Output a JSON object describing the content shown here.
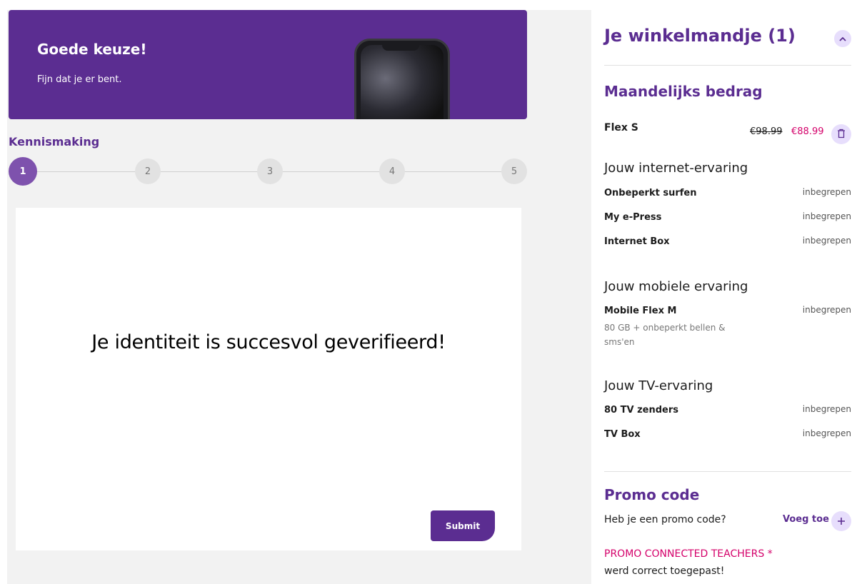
{
  "hero": {
    "title": "Goede keuze!",
    "subtitle": "Fijn dat je er bent."
  },
  "stepper": {
    "title": "Kennismaking",
    "steps": [
      "1",
      "2",
      "3",
      "4",
      "5"
    ],
    "active": "1"
  },
  "card": {
    "message": "Je identiteit is succesvol geverifieerd!",
    "submit_label": "Submit"
  },
  "cart": {
    "title": "Je winkelmandje (1)",
    "monthly_title": "Maandelijks bedrag",
    "plan": {
      "name": "Flex S",
      "old_price": "€98.99",
      "new_price": "€88.99"
    },
    "internet": {
      "title": "Jouw internet-ervaring",
      "items": [
        {
          "label": "Onbeperkt surfen",
          "value": "inbegrepen"
        },
        {
          "label": "My e-Press",
          "value": "inbegrepen"
        },
        {
          "label": "Internet Box",
          "value": "inbegrepen"
        }
      ]
    },
    "mobile": {
      "title": "Jouw mobiele ervaring",
      "items": [
        {
          "label": "Mobile Flex M",
          "value": "inbegrepen",
          "sub": "80 GB + onbeperkt bellen & sms'en"
        }
      ]
    },
    "tv": {
      "title": "Jouw TV-ervaring",
      "items": [
        {
          "label": "80 TV zenders",
          "value": "inbegrepen"
        },
        {
          "label": "TV Box",
          "value": "inbegrepen"
        }
      ]
    },
    "promo": {
      "title": "Promo code",
      "question": "Heb je een promo code?",
      "add_label": "Voeg toe",
      "applied_name": "PROMO CONNECTED TEACHERS *",
      "applied_status": "werd correct toegepast!"
    }
  },
  "colors": {
    "brand": "#5b2d91",
    "accent_pink": "#d4006a",
    "chip_bg": "#e7defc"
  }
}
